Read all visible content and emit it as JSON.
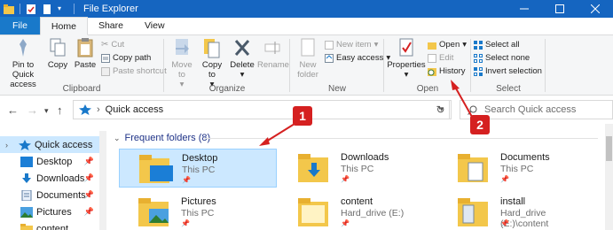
{
  "window": {
    "title": "File Explorer"
  },
  "colors": {
    "accent": "#1979ca",
    "titlebar": "#1565c0",
    "selection": "#cce8ff",
    "annotation": "#d52020",
    "folder": "#f3c74b"
  },
  "tabs": [
    {
      "label": "File"
    },
    {
      "label": "Home"
    },
    {
      "label": "Share"
    },
    {
      "label": "View"
    }
  ],
  "ribbon": {
    "clipboard": {
      "label": "Clipboard",
      "pin": "Pin to Quick access",
      "copy": "Copy",
      "paste": "Paste",
      "cut": "Cut",
      "copy_path": "Copy path",
      "paste_shortcut": "Paste shortcut"
    },
    "organize": {
      "label": "Organize",
      "move_to": "Move to",
      "copy_to": "Copy to",
      "delete": "Delete",
      "rename": "Rename"
    },
    "new": {
      "label": "New",
      "new_folder": "New folder",
      "new_item": "New item",
      "easy_access": "Easy access"
    },
    "open": {
      "label": "Open",
      "properties": "Properties",
      "open": "Open",
      "edit": "Edit",
      "history": "History"
    },
    "select": {
      "label": "Select",
      "select_all": "Select all",
      "select_none": "Select none",
      "invert": "Invert selection"
    }
  },
  "address": {
    "path": "Quick access",
    "search_placeholder": "Search Quick access"
  },
  "navpane": {
    "items": [
      {
        "label": "Quick access",
        "icon": "star-icon"
      },
      {
        "label": "Desktop",
        "icon": "desktop-icon"
      },
      {
        "label": "Downloads",
        "icon": "download-icon"
      },
      {
        "label": "Documents",
        "icon": "documents-icon"
      },
      {
        "label": "Pictures",
        "icon": "pictures-icon"
      },
      {
        "label": "content",
        "icon": "folder-icon"
      }
    ]
  },
  "main": {
    "section_title": "Frequent folders (8)",
    "folders": [
      {
        "name": "Desktop",
        "location": "This PC"
      },
      {
        "name": "Downloads",
        "location": "This PC"
      },
      {
        "name": "Documents",
        "location": "This PC"
      },
      {
        "name": "Pictures",
        "location": "This PC"
      },
      {
        "name": "content",
        "location": "Hard_drive (E:)"
      },
      {
        "name": "install",
        "location": "Hard_drive (E:)\\content"
      }
    ]
  },
  "annotations": {
    "badge1": "1",
    "badge2": "2"
  }
}
